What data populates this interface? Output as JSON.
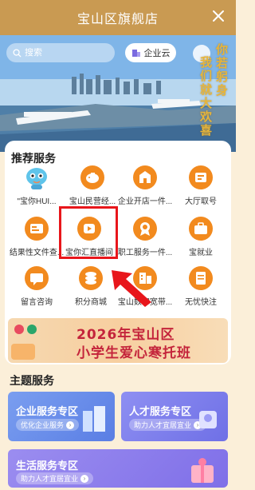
{
  "window": {
    "title": "宝山区旗舰店"
  },
  "header": {
    "search_placeholder": "搜索",
    "enterprise_cloud_label": "企业云",
    "slogan_col1": "你若躬身",
    "slogan_col2": "我们就大欢喜"
  },
  "recommend": {
    "title": "推荐服务",
    "items": [
      {
        "label": "\"宝你HUI...",
        "icon": "mascot-icon"
      },
      {
        "label": "宝山民营经...",
        "icon": "piggy-bank-icon"
      },
      {
        "label": "企业开店一件...",
        "icon": "shop-icon"
      },
      {
        "label": "大厅取号",
        "icon": "ticket-icon"
      },
      {
        "label": "结果性文件查...",
        "icon": "id-card-icon"
      },
      {
        "label": "宝你汇直播间",
        "icon": "live-stream-icon"
      },
      {
        "label": "职工服务一件...",
        "icon": "medal-icon"
      },
      {
        "label": "宝就业",
        "icon": "briefcase-icon"
      },
      {
        "label": "留言咨询",
        "icon": "message-icon"
      },
      {
        "label": "积分商城",
        "icon": "coins-icon"
      },
      {
        "label": "宝山数字宽带...",
        "icon": "building-icon"
      },
      {
        "label": "无忧快注",
        "icon": "document-icon"
      }
    ]
  },
  "promo": {
    "year_line": "2026年宝山区",
    "title_line": "小学生爱心寒托班"
  },
  "theme": {
    "title": "主题服务",
    "cards": [
      {
        "title": "企业服务专区",
        "subtitle": "优化企业服务"
      },
      {
        "title": "人才服务专区",
        "subtitle": "助力人才宜居宜业"
      },
      {
        "title": "生活服务专区",
        "subtitle": "助力人才宜居宜业"
      }
    ]
  },
  "colors": {
    "title_bar": "#c99a52",
    "page_bg": "#fbefd9",
    "highlight": "#e8161b",
    "icon_orange": "#f28a1e"
  }
}
